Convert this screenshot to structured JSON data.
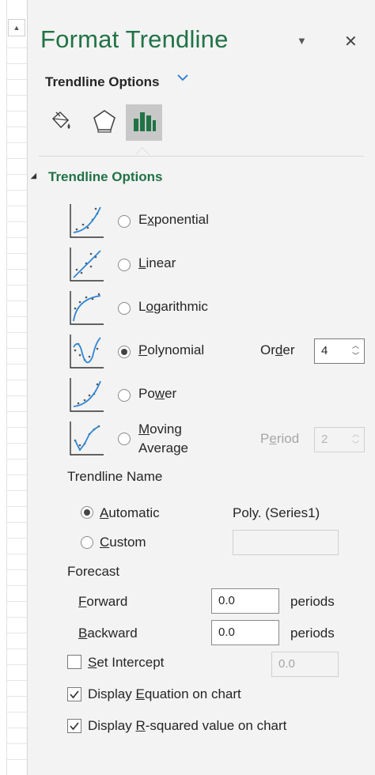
{
  "pane": {
    "title": "Format Trendline",
    "options_menu_label": "Trendline Options",
    "section_title": "Trendline Options"
  },
  "tabs": [
    {
      "icon": "fill-line-icon",
      "active": false
    },
    {
      "icon": "effects-pentagon-icon",
      "active": false
    },
    {
      "icon": "trendline-options-bar-icon",
      "active": true
    }
  ],
  "trend_types": [
    {
      "label": "Exponential",
      "icon": "exponential-trend-icon",
      "selected": false
    },
    {
      "label": "Linear",
      "icon": "linear-trend-icon",
      "selected": false
    },
    {
      "label": "Logarithmic",
      "icon": "logarithmic-trend-icon",
      "selected": false
    },
    {
      "label": "Polynomial",
      "icon": "polynomial-trend-icon",
      "selected": true
    },
    {
      "label": "Power",
      "icon": "power-trend-icon",
      "selected": false
    },
    {
      "label_line1": "Moving",
      "label_line2": "Average",
      "icon": "moving-average-trend-icon",
      "selected": false
    }
  ],
  "order": {
    "label": "Order",
    "value": "4"
  },
  "period": {
    "label": "Period",
    "value": "2"
  },
  "trendline_name": {
    "heading": "Trendline Name",
    "automatic_label": "Automatic",
    "automatic_value": "Poly. (Series1)",
    "custom_label": "Custom",
    "custom_value": ""
  },
  "forecast": {
    "heading": "Forecast",
    "forward_label": "Forward",
    "forward_value": "0.0",
    "backward_label": "Backward",
    "backward_value": "0.0",
    "unit": "periods"
  },
  "set_intercept": {
    "label": "Set Intercept",
    "value": "0.0",
    "checked": false
  },
  "display_equation": {
    "label": "Display Equation on chart",
    "checked": true
  },
  "display_rsquared": {
    "label": "Display R-squared value on chart",
    "checked": true
  },
  "colors": {
    "accent_green": "#217346",
    "chevron_blue": "#2b79d0",
    "curve_blue": "#2e86d4"
  }
}
